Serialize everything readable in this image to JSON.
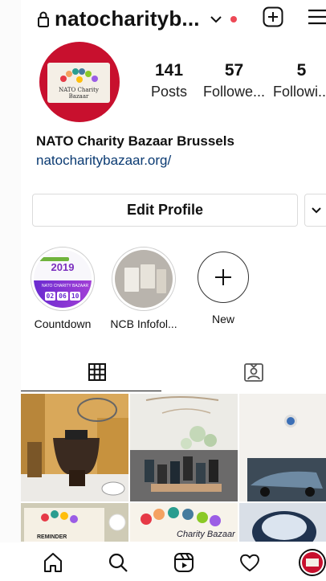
{
  "header": {
    "username": "natocharityb...",
    "lock_icon": "lock-icon",
    "notification_color": "#ed4956"
  },
  "profile": {
    "avatar_caption": "NATO Charity Bazaar",
    "stats": [
      {
        "value": "141",
        "label": "Posts"
      },
      {
        "value": "57",
        "label": "Followe..."
      },
      {
        "value": "5",
        "label": "Followi..."
      }
    ],
    "name": "NATO Charity Bazaar Brussels",
    "website": "natocharitybazaar.org/"
  },
  "actions": {
    "edit_profile": "Edit Profile"
  },
  "highlights": [
    {
      "label": "Countdown",
      "year": "2019",
      "banner": "NATO CHARITY BAZAAR",
      "digits": [
        "02",
        "06",
        "10"
      ]
    },
    {
      "label": "NCB Infofol..."
    },
    {
      "label": "New"
    }
  ],
  "tabs": [
    {
      "icon": "grid-icon",
      "active": true
    },
    {
      "icon": "tagged-icon",
      "active": false
    }
  ],
  "grid": {
    "post_texts": [
      "Charity Bazaar",
      "Charity Bazaar",
      "REMINDER"
    ]
  },
  "nav": [
    "home-icon",
    "search-icon",
    "reels-icon",
    "heart-icon",
    "profile-avatar"
  ],
  "colors": {
    "brand_red": "#c8102e",
    "link": "#0a3a72",
    "border": "#dbdbdb"
  }
}
